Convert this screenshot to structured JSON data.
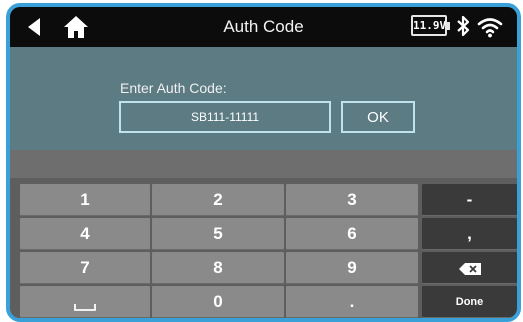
{
  "header": {
    "title": "Auth Code",
    "battery_voltage": "11.9V"
  },
  "auth": {
    "label": "Enter Auth Code:",
    "value": "SB111-11111",
    "ok_label": "OK"
  },
  "keyboard": {
    "keys": {
      "k1": "1",
      "k2": "2",
      "k3": "3",
      "minus": "-",
      "k4": "4",
      "k5": "5",
      "k6": "6",
      "comma": ",",
      "k7": "7",
      "k8": "8",
      "k9": "9",
      "k0": "0",
      "dot": ".",
      "done": "Done"
    }
  },
  "icons": {
    "back": "back-arrow-icon",
    "home": "home-icon",
    "battery": "battery-icon",
    "bluetooth": "bluetooth-icon",
    "wifi": "wifi-icon",
    "backspace": "backspace-icon",
    "space": "space-icon"
  },
  "colors": {
    "frame_border": "#3aa0d8",
    "top_bar": "#0c0c0c",
    "panel": "#5c7b82",
    "input_border": "#bfe2ec",
    "key": "#8a8a8a",
    "function_key": "#3a3a3a"
  }
}
